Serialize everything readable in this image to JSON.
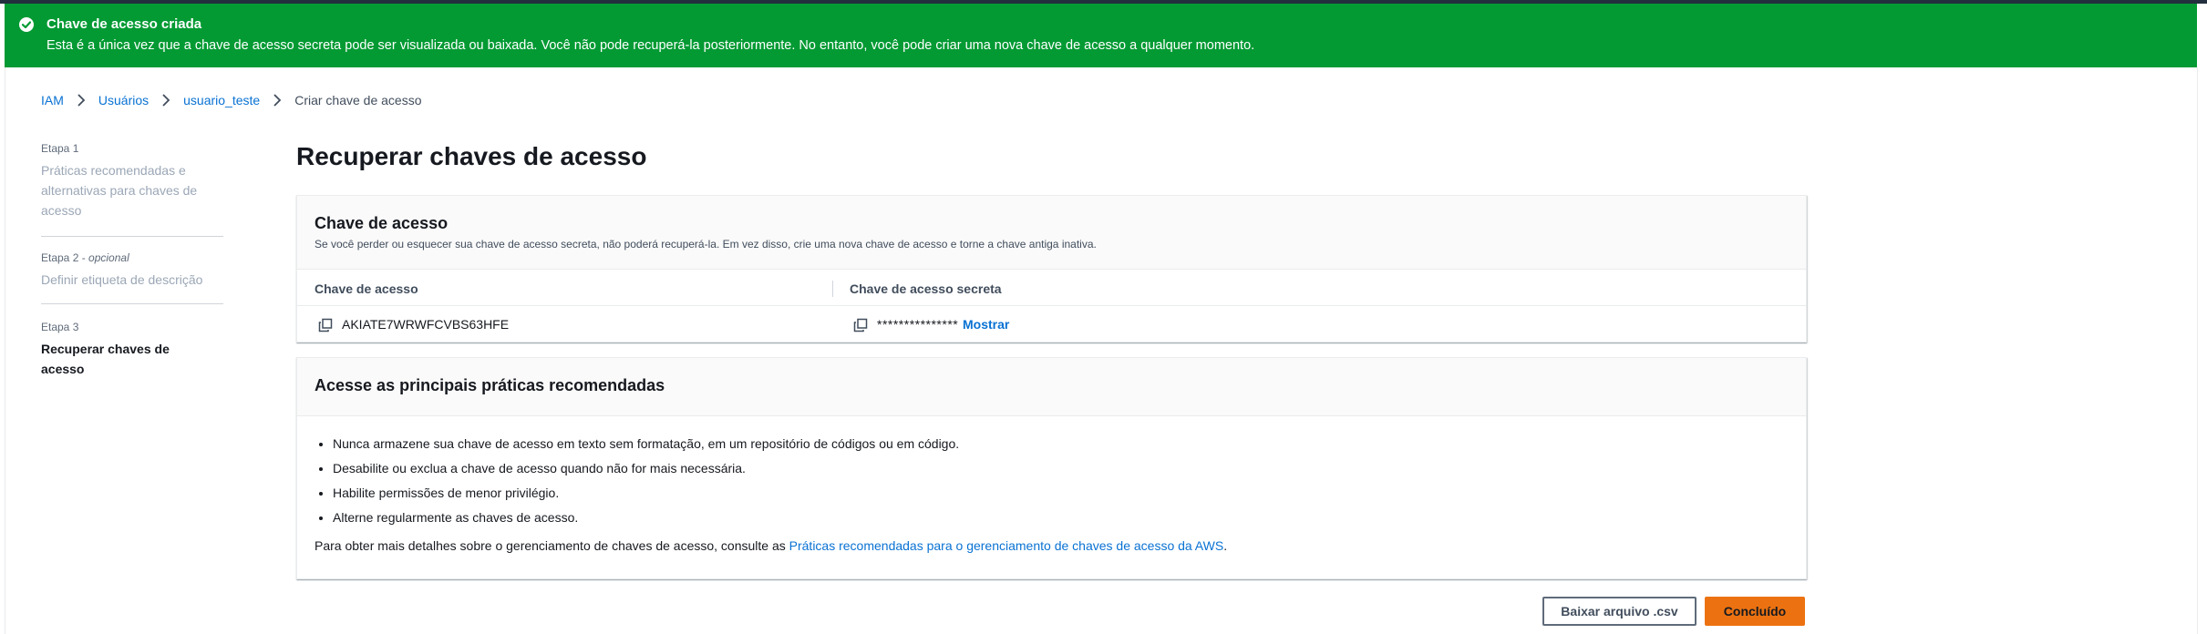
{
  "colors": {
    "success": "#039a33",
    "link": "#0972d3",
    "primary_button": "#ec7211"
  },
  "flash": {
    "icon": "check-circle-icon",
    "title": "Chave de acesso criada",
    "message": "Esta é a única vez que a chave de acesso secreta pode ser visualizada ou baixada. Você não pode recuperá-la posteriormente. No entanto, você pode criar uma nova chave de acesso a qualquer momento."
  },
  "breadcrumb": {
    "items": [
      "IAM",
      "Usuários",
      "usuario_teste"
    ],
    "current": "Criar chave de acesso"
  },
  "steps": [
    {
      "label": "Etapa 1",
      "optional": "",
      "title": "Práticas recomendadas e alternativas para chaves de acesso"
    },
    {
      "label": "Etapa 2",
      "optional": "opcional",
      "title": "Definir etiqueta de descrição"
    },
    {
      "label": "Etapa 3",
      "optional": "",
      "title": "Recuperar chaves de acesso"
    }
  ],
  "page_title": "Recuperar chaves de acesso",
  "access_key_card": {
    "title": "Chave de acesso",
    "description": "Se você perder ou esquecer sua chave de acesso secreta, não poderá recuperá-la. Em vez disso, crie uma nova chave de acesso e torne a chave antiga inativa.",
    "columns": [
      "Chave de acesso",
      "Chave de acesso secreta"
    ],
    "access_key_id": "AKIATE7WRWFCVBS63HFE",
    "secret_masked": "***************",
    "show_label": "Mostrar"
  },
  "best_practices": {
    "title": "Acesse as principais práticas recomendadas",
    "items": [
      "Nunca armazene sua chave de acesso em texto sem formatação, em um repositório de códigos ou em código.",
      "Desabilite ou exclua a chave de acesso quando não for mais necessária.",
      "Habilite permissões de menor privilégio.",
      "Alterne regularmente as chaves de acesso."
    ],
    "footer_prefix": "Para obter mais detalhes sobre o gerenciamento de chaves de acesso, consulte as ",
    "footer_link": "Práticas recomendadas para o gerenciamento de chaves de acesso da AWS",
    "footer_suffix": "."
  },
  "actions": {
    "download_csv": "Baixar arquivo .csv",
    "done": "Concluído"
  }
}
